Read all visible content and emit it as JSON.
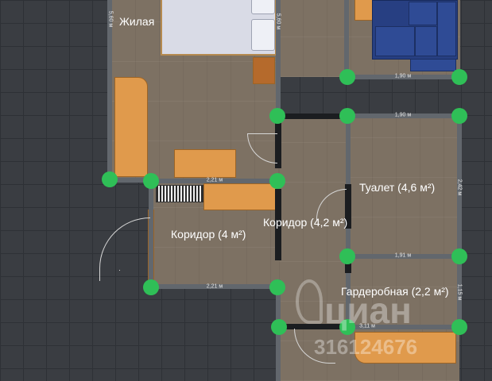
{
  "rooms": {
    "living": "Жилая",
    "toilet": "Туалет (4,6 м²)",
    "corridor_right": "Коридор (4,2 м²)",
    "corridor_left": "Коридор (4 м²)",
    "wardrobe": "Гардеробная (2,2 м²)"
  },
  "dimensions": {
    "living_left": "5,60 м",
    "living_right": "5,60 м",
    "top_right": "1,90 м",
    "toilet_top": "1,90 м",
    "toilet_right": "2,42 м",
    "toilet_bottom": "1,91 м",
    "corridor_left_top": "2,21 м",
    "corridor_left_bottom": "2,21 м",
    "wardrobe_right": "1,15 м",
    "wardrobe_bottom": "3,11 м"
  },
  "watermark": {
    "brand": "циан",
    "phone": "316124676"
  },
  "colors": {
    "node": "#2fbf57",
    "floor": "#7d7163",
    "grid_bg": "#3a3d42",
    "furniture": "#e09a4c",
    "sofa": "#273f82"
  }
}
